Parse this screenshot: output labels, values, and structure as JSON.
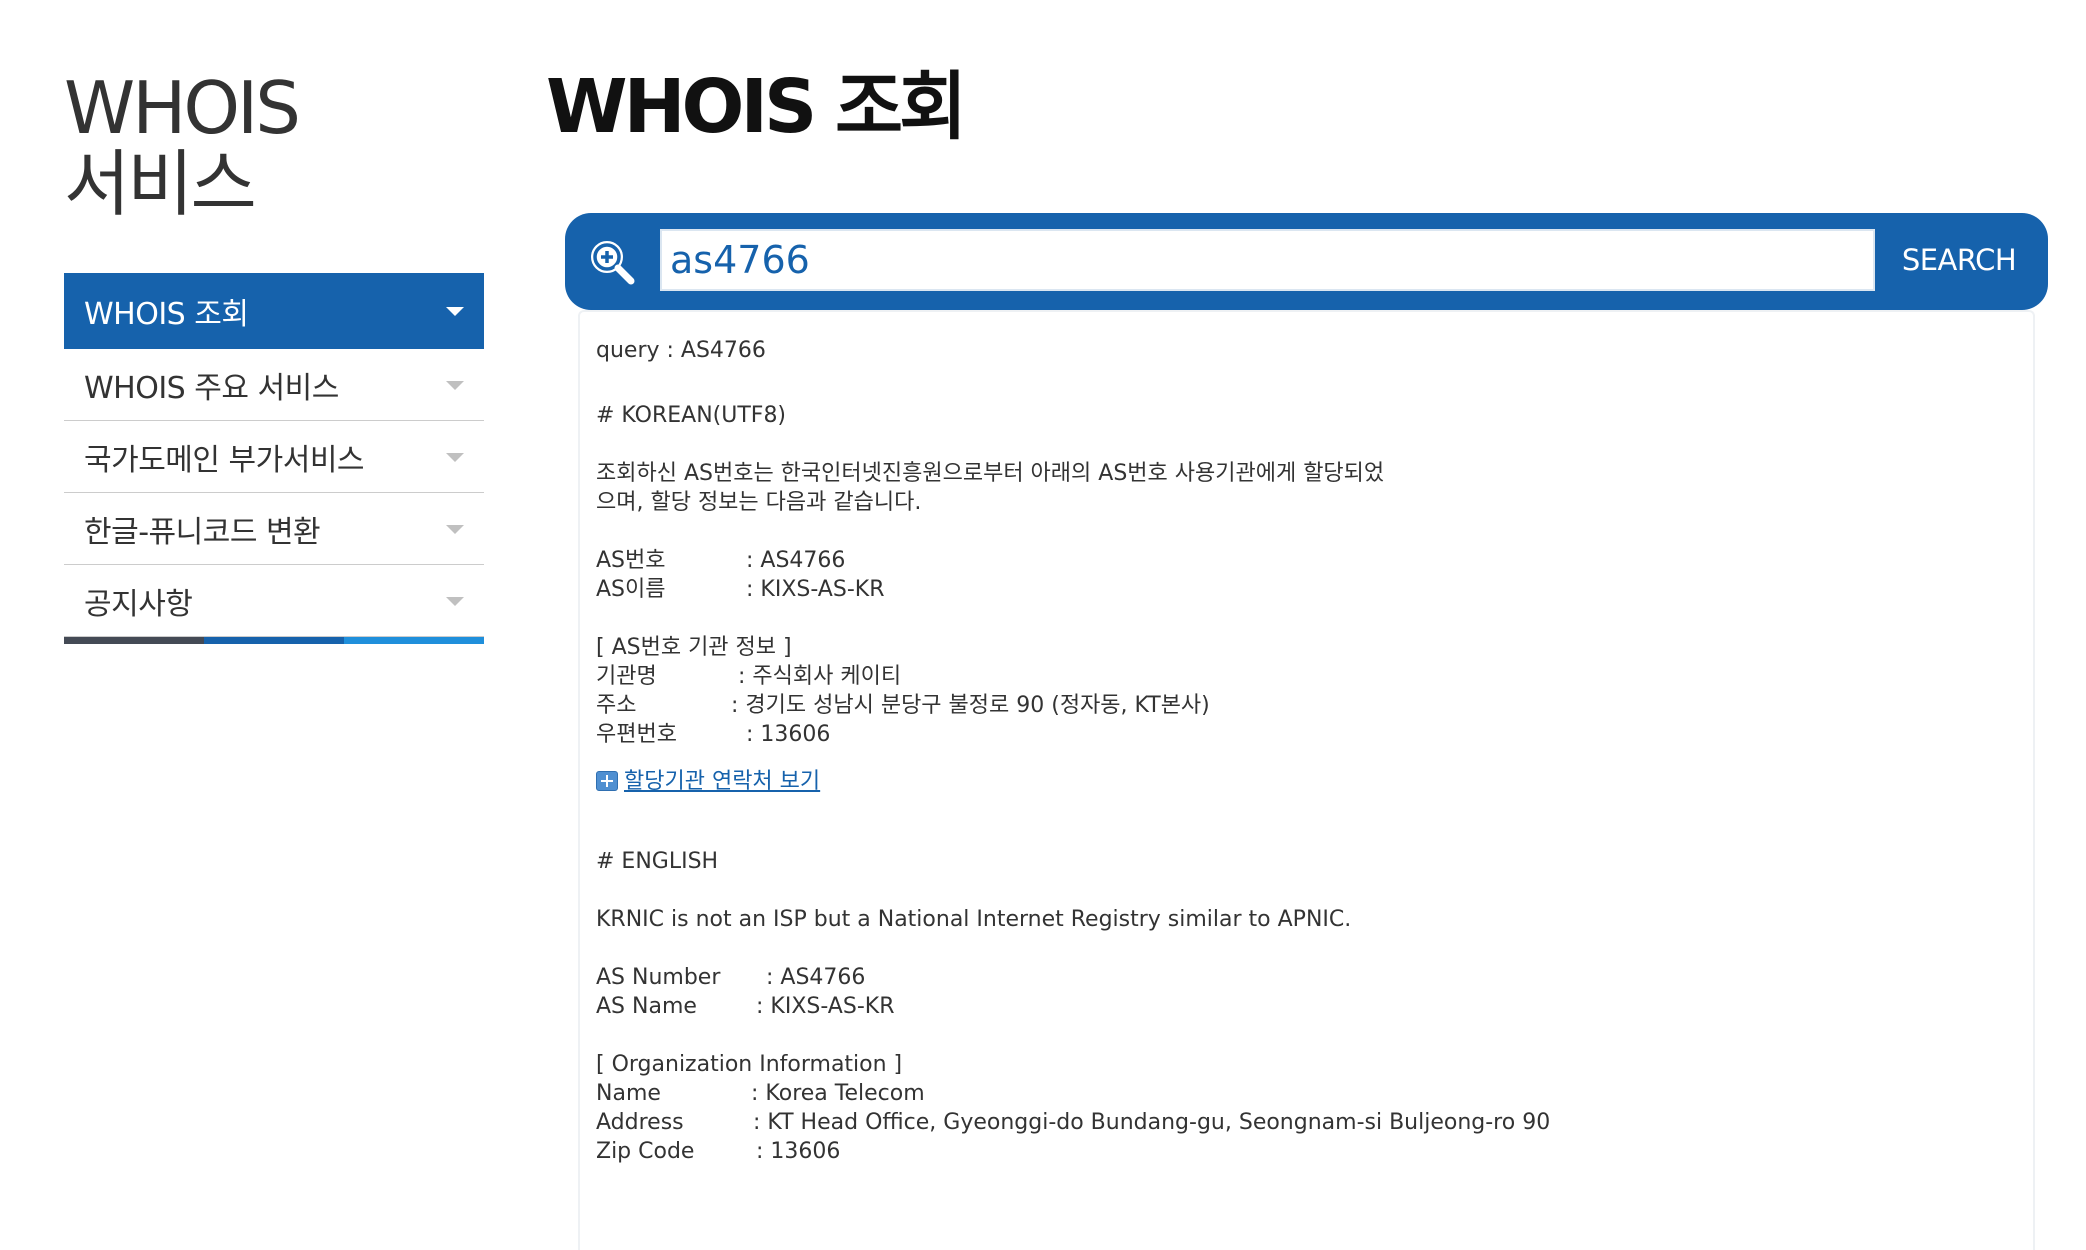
{
  "sidebar": {
    "title_line1": "WHOIS",
    "title_line2": "서비스",
    "items": [
      {
        "label": "WHOIS 조회"
      },
      {
        "label": "WHOIS 주요 서비스"
      },
      {
        "label": "국가도메인 부가서비스"
      },
      {
        "label": "한글-퓨니코드 변환"
      },
      {
        "label": "공지사항"
      }
    ]
  },
  "main": {
    "title": "WHOIS 조회",
    "search": {
      "value": "as4766",
      "button_label": "SEARCH"
    },
    "result": {
      "query": "query : AS4766",
      "korean_header": "# KOREAN(UTF8)",
      "korean_intro_1": "조회하신 AS번호는 한국인터넷진흥원으로부터 아래의 AS번호 사용기관에게 할당되었",
      "korean_intro_2": "으며, 할당 정보는 다음과 같습니다.",
      "ko_as_number": {
        "key": "AS번호",
        "value": ": AS4766"
      },
      "ko_as_name": {
        "key": "AS이름",
        "value": ": KIXS-AS-KR"
      },
      "ko_org_header": "[ AS번호 기관 정보 ]",
      "ko_org_name": {
        "key": "기관명",
        "value": ": 주식회사 케이티"
      },
      "ko_org_address": {
        "key": "주소",
        "value": ": 경기도 성남시 분당구 불정로 90 (정자동, KT본사)"
      },
      "ko_org_zip": {
        "key": "우편번호",
        "value": ": 13606"
      },
      "contact_link": "할당기관 연락처 보기",
      "english_header": "# ENGLISH",
      "english_intro": "KRNIC is not an ISP but a National Internet Registry similar to APNIC.",
      "en_as_number": {
        "key": "AS Number",
        "value": ": AS4766"
      },
      "en_as_name": {
        "key": "AS Name",
        "value": ": KIXS-AS-KR"
      },
      "en_org_header": "[ Organization Information ]",
      "en_org_name": {
        "key": "Name",
        "value": ": Korea Telecom"
      },
      "en_org_address": {
        "key": "Address",
        "value": ": KT Head Office, Gyeonggi-do Bundang-gu, Seongnam-si Buljeong-ro 90"
      },
      "en_org_zip": {
        "key": "Zip Code",
        "value": ": 13606"
      }
    }
  },
  "colors": {
    "primary_blue": "#1662ac",
    "sky_blue": "#1f8fdb",
    "dark_bar": "#444a55"
  },
  "icons": {
    "search": "magnifier-plus-icon",
    "menu_arrow": "triangle-down-icon",
    "contact_plus": "plus-box-icon"
  }
}
